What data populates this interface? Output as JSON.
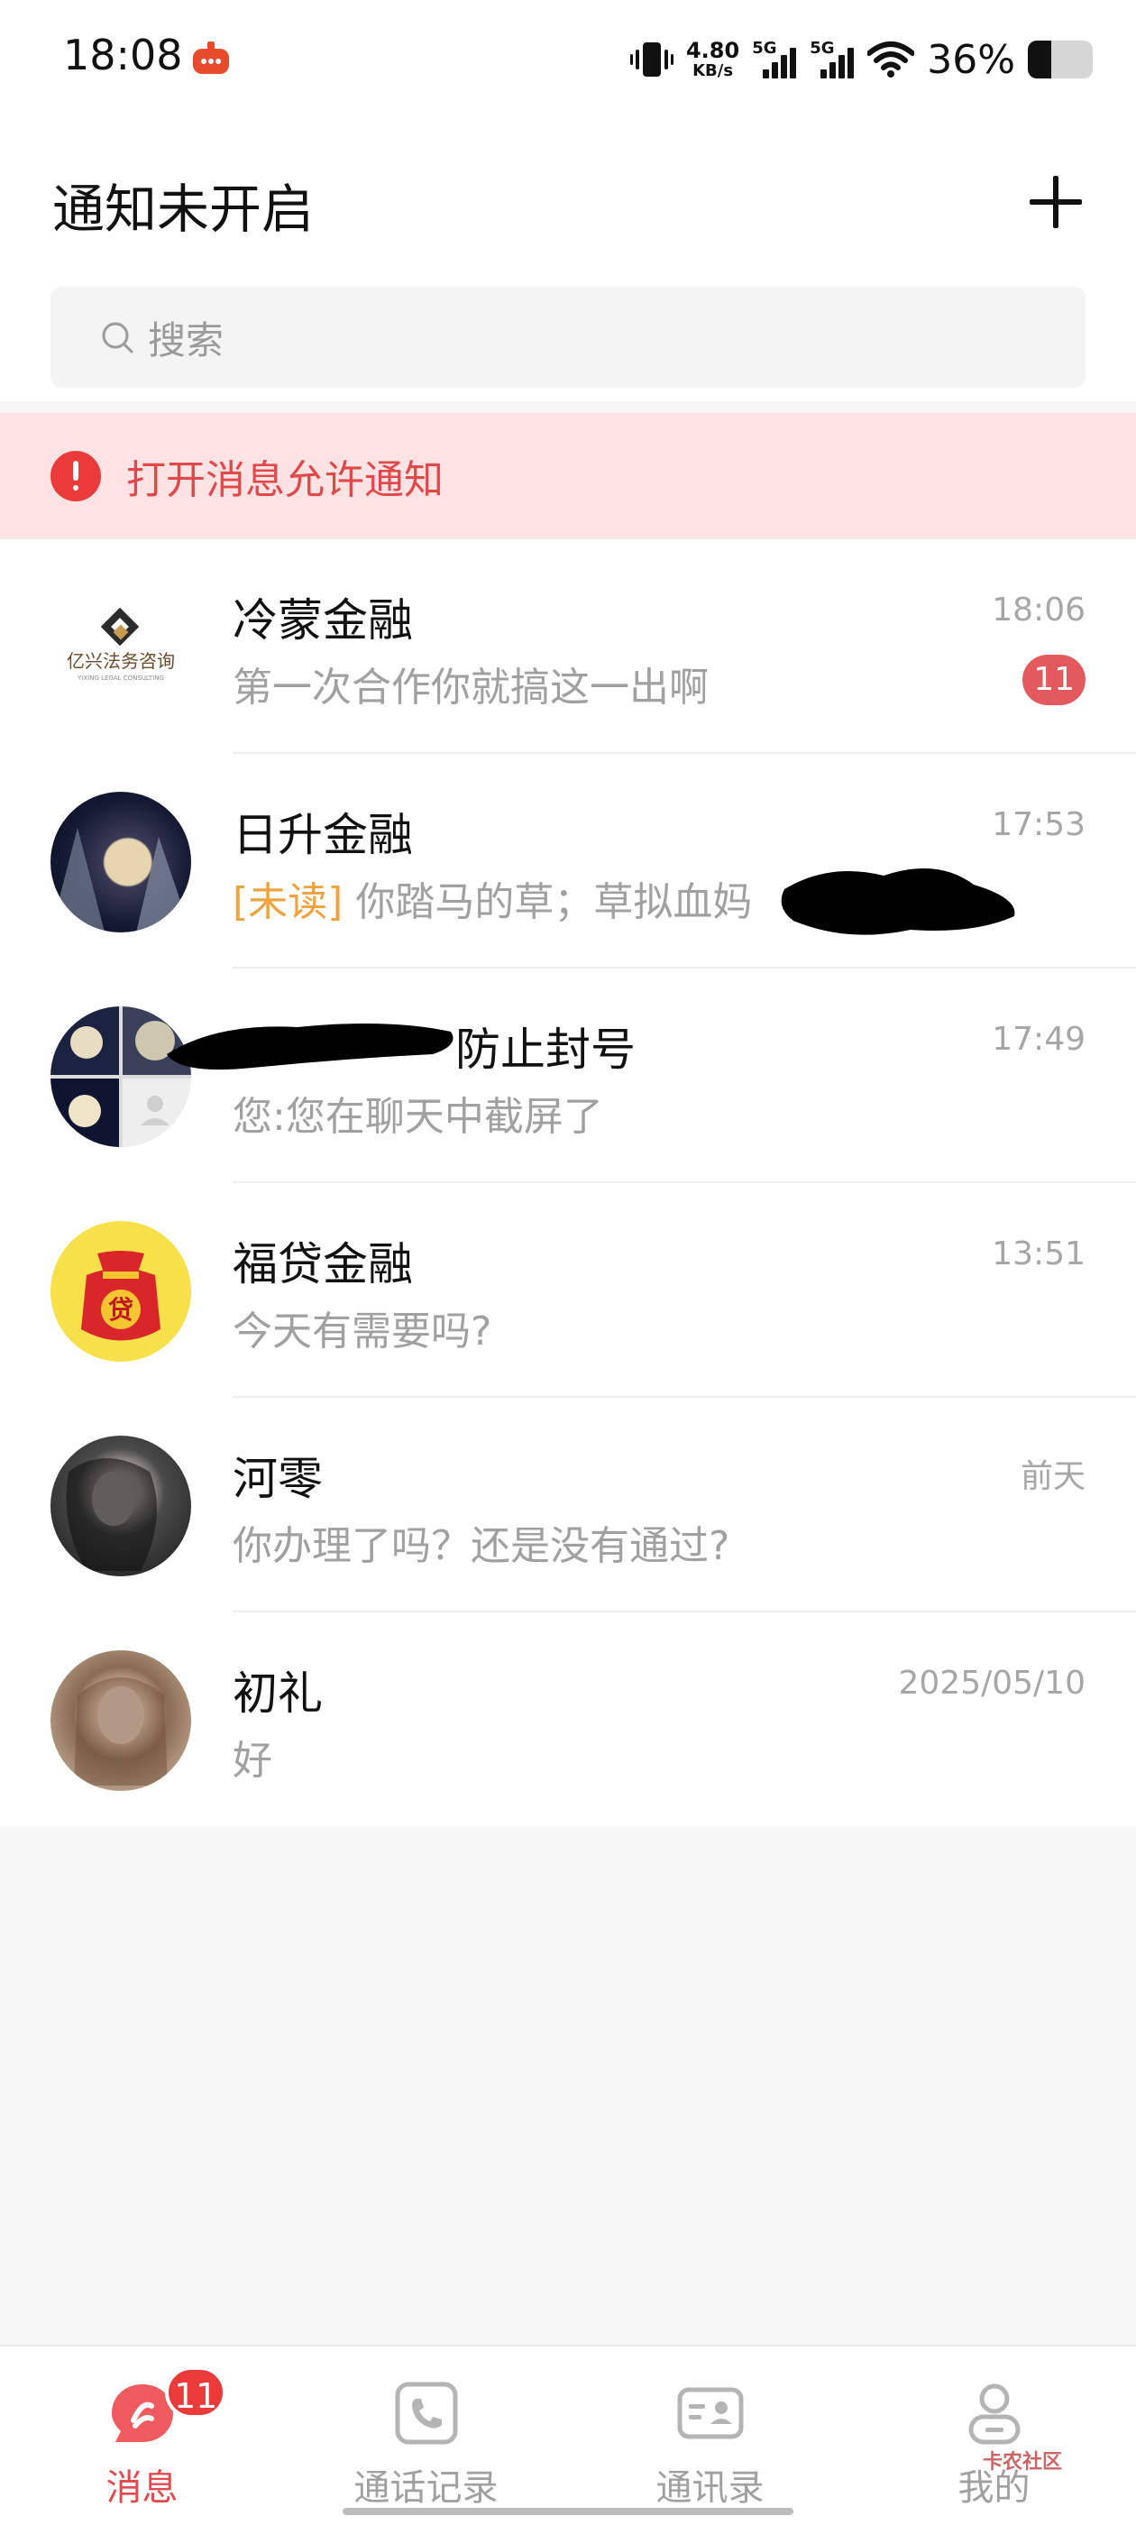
{
  "status_bar": {
    "time": "18:08",
    "net_speed_value": "4.80",
    "net_speed_unit": "KB/s",
    "sim1_label": "5G",
    "sim2_label": "5G",
    "battery_percent": "36%",
    "battery_level": 0.36
  },
  "header": {
    "title": "通知未开启",
    "search_placeholder": "搜索"
  },
  "banner": {
    "text": "打开消息允许通知"
  },
  "conversations": [
    {
      "name": "冷蒙金融",
      "preview": "第一次合作你就搞这一出啊",
      "time": "18:06",
      "unread": "11",
      "logo_text": "亿兴法务咨询",
      "logo_subtext": "YIXING LEGAL CONSULTING"
    },
    {
      "name": "日升金融",
      "preview_tag": "[未读]",
      "preview": "你踏马的草；草拟血妈",
      "time": "17:53"
    },
    {
      "name": "防止封号",
      "preview": "您:您在聊天中截屏了",
      "time": "17:49"
    },
    {
      "name": "福贷金融",
      "preview": "今天有需要吗?",
      "time": "13:51",
      "avatar_char": "贷"
    },
    {
      "name": "河零",
      "preview": "你办理了吗？还是没有通过?",
      "time": "前天"
    },
    {
      "name": "初礼",
      "preview": "好",
      "time": "2025/05/10"
    }
  ],
  "tabs": [
    {
      "label": "消息",
      "badge": "11",
      "active": true
    },
    {
      "label": "通话记录"
    },
    {
      "label": "通讯录"
    },
    {
      "label": "我的"
    }
  ],
  "watermark": "卡农社区",
  "colors": {
    "accent": "#e5484d",
    "banner_bg": "#fde3e3",
    "unread_tag": "#f0a33c",
    "badge": "#e35a5e"
  }
}
